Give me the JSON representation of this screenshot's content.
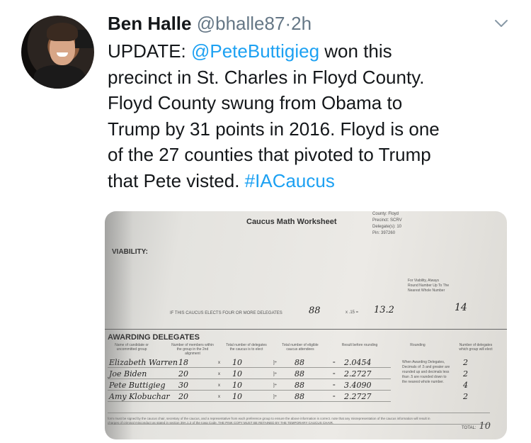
{
  "tweet": {
    "author_name": "Ben Halle",
    "handle": "@bhalle87",
    "separator": "·",
    "time": "2h",
    "lines": [
      [
        {
          "t": "UPDATE: "
        },
        {
          "t": "@PeteButtigieg",
          "link": true
        },
        {
          "t": " won this"
        }
      ],
      [
        {
          "t": "precinct in St. Charles in Floyd County."
        }
      ],
      [
        {
          "t": "Floyd County swung from Obama to"
        }
      ],
      [
        {
          "t": "Trump by 31 points in 2016. Floyd is one"
        }
      ],
      [
        {
          "t": "of the 27 counties that pivoted to Trump"
        }
      ],
      [
        {
          "t": "that Pete visted. "
        },
        {
          "t": "#IACaucus",
          "link": true
        }
      ]
    ]
  },
  "colors": {
    "link": "#1da1f2",
    "secondary_text": "#657786",
    "primary_text": "#14171a"
  },
  "icons": {
    "chevron": "chevron-down-icon",
    "avatar": "avatar"
  },
  "worksheet": {
    "title": "Caucus Math Worksheet",
    "meta": [
      "County: Floyd",
      "Precinct: SCRV",
      "Delegate(s): 10",
      "Pin: 397260"
    ],
    "viability_label": "VIABILITY:",
    "round_note": "For Viability, Always Round Number Up To The Nearest Whole Number",
    "if_text": "IF THIS CAUCUS ELECTS FOUR OR MORE DELEGATES",
    "eligible_value": "88",
    "times_value": "x .15 =",
    "result_value": "13.2",
    "rounded_value": "14",
    "awarding_label": "AWARDING DELEGATES",
    "columns": [
      "Name of candidate or uncommitted group",
      "Number of members within the group in the 2nd alignment",
      "Total number of delegates the caucus is to elect",
      "Total number of eligible caucus attendees",
      "Result before rounding",
      "Rounding",
      "Number of delegates which group will elect"
    ],
    "rows": [
      {
        "name": "Elizabeth Warren",
        "members": "18",
        "delegates": "10",
        "eligible": "88",
        "result": "2.0454",
        "award": "2"
      },
      {
        "name": "Joe Biden",
        "members": "20",
        "delegates": "10",
        "eligible": "88",
        "result": "2.2727",
        "award": "2"
      },
      {
        "name": "Pete Buttigieg",
        "members": "30",
        "delegates": "10",
        "eligible": "88",
        "result": "3.4090",
        "award": "4"
      },
      {
        "name": "Amy Klobuchar",
        "members": "20",
        "delegates": "10",
        "eligible": "88",
        "result": "2.2727",
        "award": "2"
      }
    ],
    "rounding_note": "When Awarding Delegates, Decimals of .5 and greater are rounded up and decimals less than .5 are rounded down to the nearest whole number.",
    "footer": "form must be signed by the caucus chair, secretary of the caucus, and a representative from each preference group to ensure the above information is correct. note that any misrepresentation of the caucus information will result in charges of criminal misconduct as stated in section 39A.1.2 of the Iowa Code. THE PINK COPY MUST BE RETAINED BY THE TEMPORARY CAUCUS CHAIR.",
    "total_label": "TOTAL",
    "total_value": "10"
  }
}
